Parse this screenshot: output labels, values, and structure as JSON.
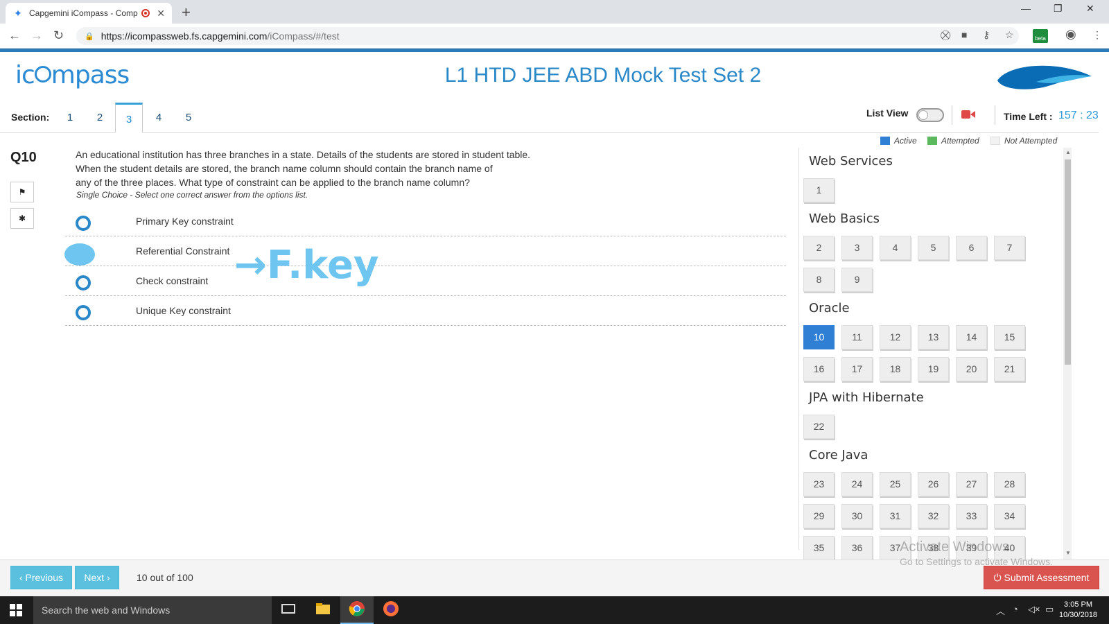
{
  "browser": {
    "tab_title": "Capgemini iCompass - Comp",
    "tab_close": "✕",
    "new_tab": "+",
    "url_host": "https://icompassweb.fs.capgemini.com",
    "url_path": "/iCompass/#/test",
    "beta_badge": "beta"
  },
  "header": {
    "logo_text_left": "ic",
    "logo_text_right": "mpass",
    "title": "L1 HTD JEE ABD Mock Test Set 2"
  },
  "sections": {
    "label": "Section:",
    "tabs": [
      "1",
      "2",
      "3",
      "4",
      "5"
    ],
    "active_index": 2
  },
  "controls": {
    "list_view_label": "List View",
    "time_left_label": "Time Left :",
    "time_left_value": "157 : 23"
  },
  "legend": {
    "active": "Active",
    "attempted": "Attempted",
    "not_attempted": "Not Attempted",
    "colors": {
      "active": "#2f7fd4",
      "attempted": "#5cb85c",
      "not_attempted": "#f2f2f2"
    }
  },
  "question": {
    "number": "Q10",
    "text_lines": [
      "An educational institution has three branches in a state. Details of the students are stored in student table.",
      "When the student details are stored, the branch name column should contain the branch name of",
      "any of the three places. What type of constraint can be applied to the branch name column?"
    ],
    "hint": "Single Choice - Select one correct answer from the options list.",
    "options": [
      "Primary Key constraint",
      "Referential Constraint",
      "Check constraint",
      "Unique Key constraint"
    ],
    "annotation": "→F.key"
  },
  "panel": {
    "groups": [
      {
        "title": "Web Services",
        "questions": [
          "1"
        ]
      },
      {
        "title": "Web Basics",
        "questions": [
          "2",
          "3",
          "4",
          "5",
          "6",
          "7",
          "8",
          "9"
        ]
      },
      {
        "title": "Oracle",
        "questions": [
          "10",
          "11",
          "12",
          "13",
          "14",
          "15",
          "16",
          "17",
          "18",
          "19",
          "20",
          "21"
        ]
      },
      {
        "title": "JPA with Hibernate",
        "questions": [
          "22"
        ]
      },
      {
        "title": "Core Java",
        "questions": [
          "23",
          "24",
          "25",
          "26",
          "27",
          "28",
          "29",
          "30",
          "31",
          "32",
          "33",
          "34",
          "35",
          "36",
          "37",
          "38",
          "39",
          "40"
        ]
      }
    ],
    "active_question": "10"
  },
  "footer": {
    "previous": "‹ Previous",
    "next": "Next ›",
    "counter": "10 out of 100",
    "submit": "⏻ Submit Assessment"
  },
  "watermark": {
    "line1": "Activate Windows",
    "line2": "Go to Settings to activate Windows."
  },
  "taskbar": {
    "search_placeholder": "Search the web and Windows",
    "time": "3:05 PM",
    "date": "10/30/2018"
  }
}
